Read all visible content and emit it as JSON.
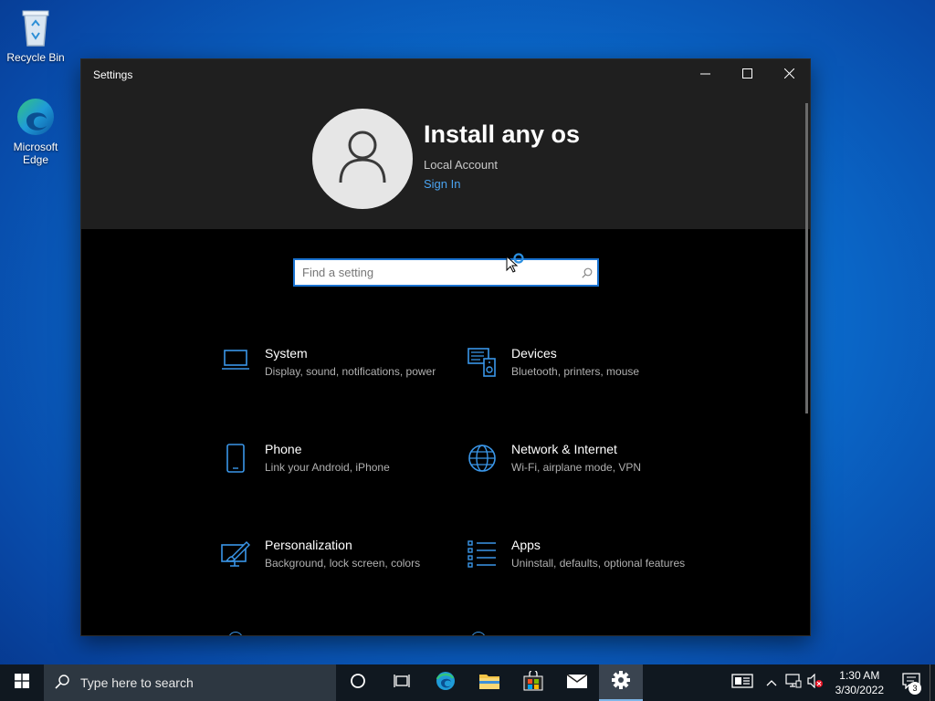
{
  "desktop": {
    "icons": [
      {
        "label": "Recycle Bin",
        "icon": "recycle-bin-icon"
      },
      {
        "label": "Microsoft Edge",
        "icon": "edge-icon"
      }
    ]
  },
  "window": {
    "title": "Settings",
    "controls": {
      "minimize": "minimize-icon",
      "maximize": "maximize-icon",
      "close": "close-icon"
    }
  },
  "account": {
    "name": "Install any os",
    "type": "Local Account",
    "sign_in": "Sign In"
  },
  "search": {
    "placeholder": "Find a setting"
  },
  "categories": [
    {
      "title": "System",
      "desc": "Display, sound, notifications, power",
      "icon": "laptop-icon"
    },
    {
      "title": "Devices",
      "desc": "Bluetooth, printers, mouse",
      "icon": "devices-icon"
    },
    {
      "title": "Phone",
      "desc": "Link your Android, iPhone",
      "icon": "phone-icon"
    },
    {
      "title": "Network & Internet",
      "desc": "Wi-Fi, airplane mode, VPN",
      "icon": "globe-icon"
    },
    {
      "title": "Personalization",
      "desc": "Background, lock screen, colors",
      "icon": "paintbrush-icon"
    },
    {
      "title": "Apps",
      "desc": "Uninstall, defaults, optional features",
      "icon": "apps-list-icon"
    }
  ],
  "taskbar": {
    "search_text": "Type here to search",
    "time": "1:30 AM",
    "date": "3/30/2022",
    "notification_count": "3",
    "accent": "#0078d7"
  },
  "colors": {
    "link": "#4aa3f0",
    "icon_accent": "#3a96e8"
  }
}
